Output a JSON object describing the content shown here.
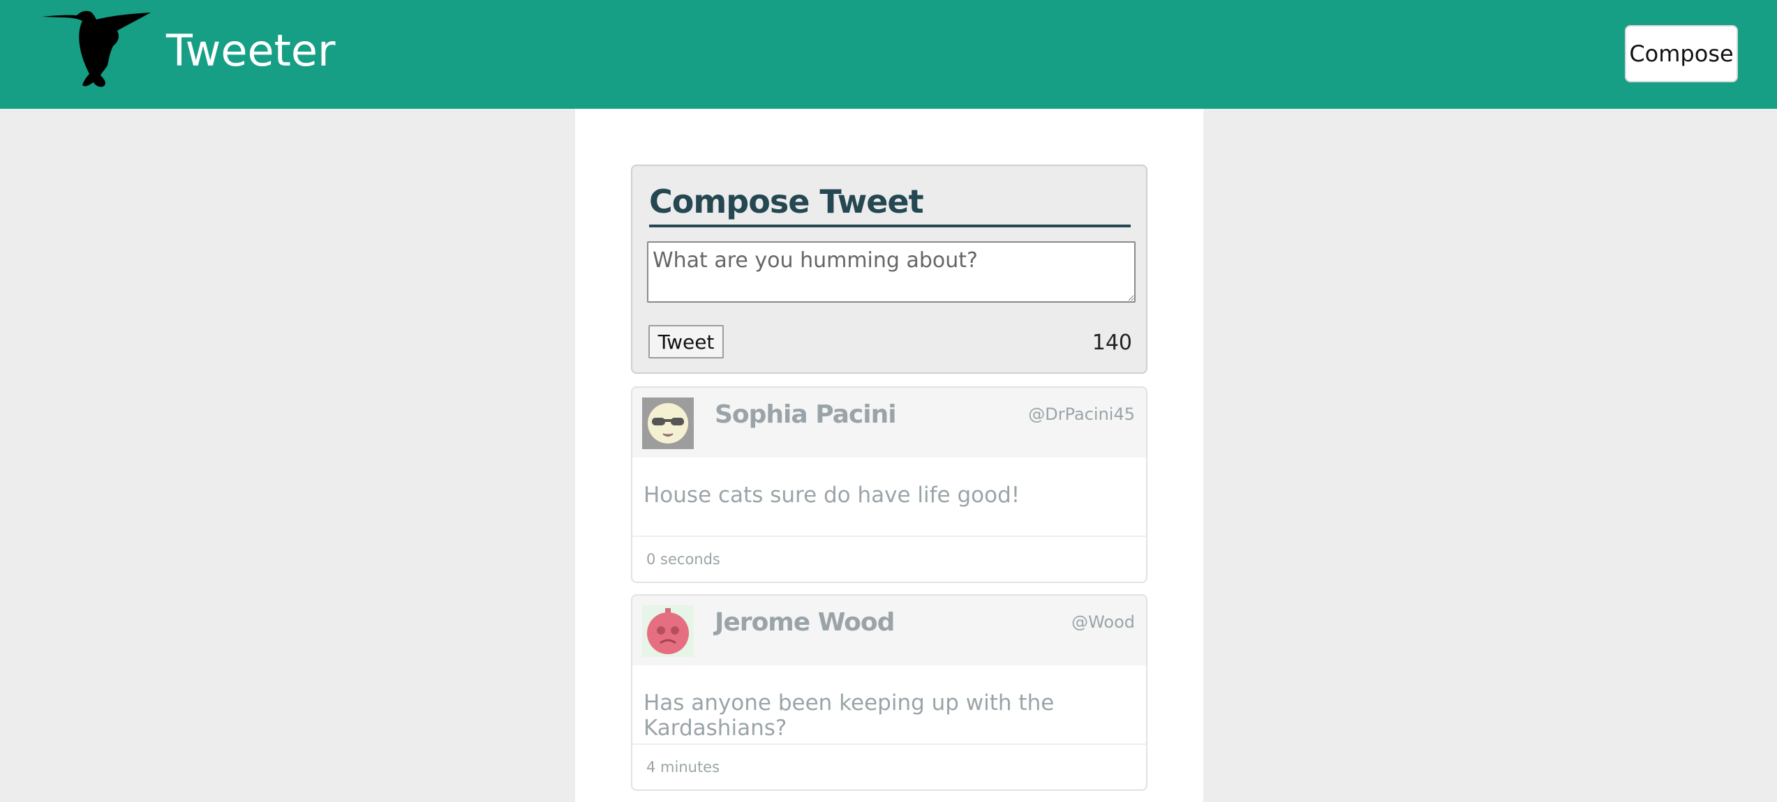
{
  "header": {
    "brand": "Tweeter",
    "compose_label": "Compose",
    "logo_icon": "hummingbird-icon",
    "bg_color": "#179f86"
  },
  "composer": {
    "title": "Compose Tweet",
    "placeholder": "What are you humming about?",
    "value": "",
    "submit_label": "Tweet",
    "counter": "140"
  },
  "tweets": [
    {
      "name": "Sophia Pacini",
      "handle": "@DrPacini45",
      "text": "House cats sure do have life good!",
      "time": "0 seconds",
      "avatar_icon": "sunglasses-avatar-icon"
    },
    {
      "name": "Jerome Wood",
      "handle": "@Wood",
      "text": "Has anyone been keeping up with the Kardashians?",
      "time": "4 minutes",
      "avatar_icon": "red-ornament-avatar-icon"
    }
  ]
}
